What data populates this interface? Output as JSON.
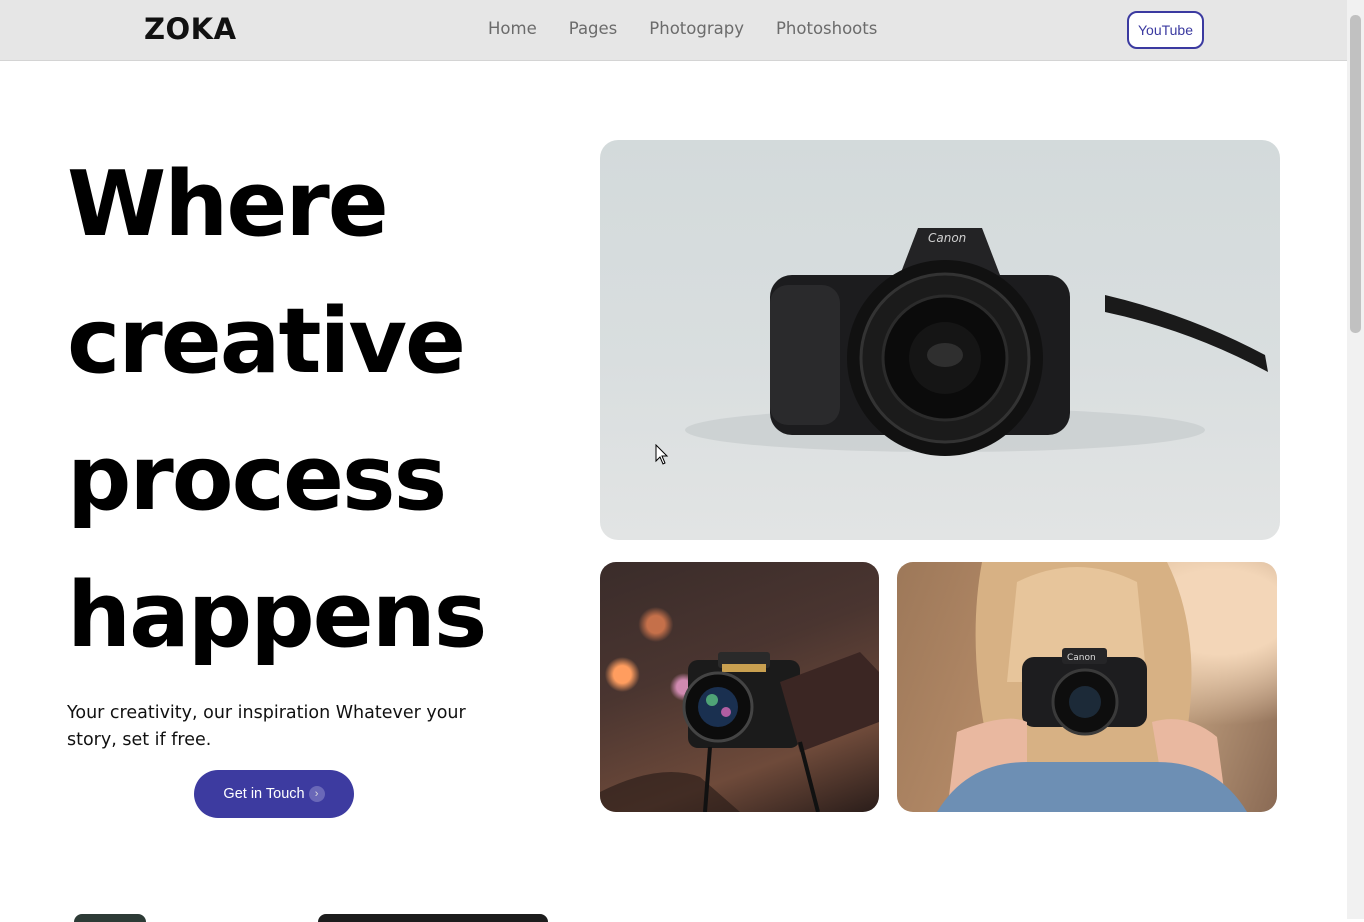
{
  "nav": {
    "logo": "ZOKA",
    "links": [
      "Home",
      "Pages",
      "Photograpy",
      "Photoshoots"
    ],
    "cta_label": "YouTube"
  },
  "hero": {
    "title_lines": [
      "Where",
      "creative",
      "process",
      "happens"
    ],
    "subtitle": "Your creativity, our inspiration Whatever your story, set if free.",
    "cta_label": "Get in Touch",
    "cta_icon": "chevron-right-icon"
  },
  "images": {
    "main": "camera-lens-photo",
    "secondary": [
      "camera-night-bokeh-photo",
      "woman-with-camera-photo"
    ]
  },
  "colors": {
    "accent": "#3d3ba0",
    "nav_bg": "#e6e6e6",
    "nav_link": "#6b6b6b",
    "heading": "#000000"
  }
}
